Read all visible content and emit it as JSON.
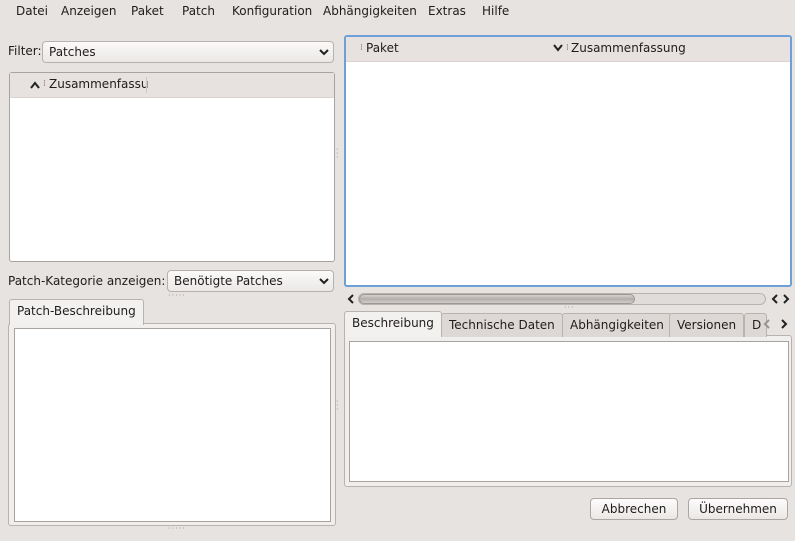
{
  "menubar": {
    "items": [
      "Datei",
      "Anzeigen",
      "Paket",
      "Patch",
      "Konfiguration",
      "Abhängigkeiten",
      "Extras",
      "Hilfe"
    ]
  },
  "left": {
    "filter_label": "Filter:",
    "filter_value": "Patches",
    "patch_list_header": "Zusammenfassu",
    "category_label": "Patch-Kategorie anzeigen:",
    "category_value": "Benötigte Patches",
    "description_tab": "Patch-Beschreibung"
  },
  "right": {
    "package_table": {
      "columns": [
        "Paket",
        "Zusammenfassung"
      ]
    },
    "scrollbar": {
      "position": 0.0,
      "visible_fraction": 0.68
    },
    "detail_tabs": [
      "Beschreibung",
      "Technische Daten",
      "Abhängigkeiten",
      "Versionen",
      "D"
    ]
  },
  "buttons": {
    "cancel": "Abbrechen",
    "accept": "Übernehmen"
  }
}
